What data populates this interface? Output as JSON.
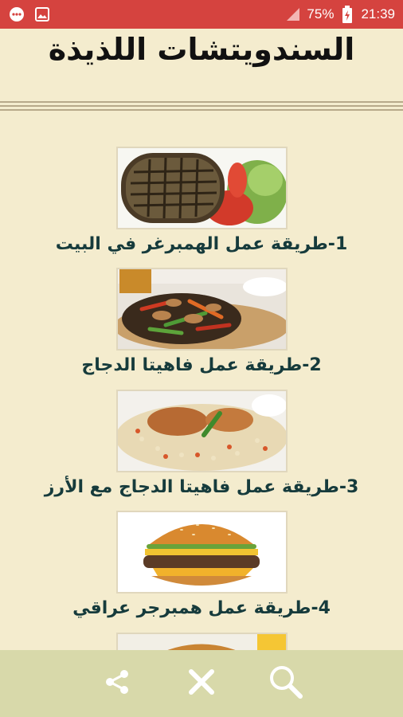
{
  "status_bar": {
    "battery": "75%",
    "time": "21:39",
    "icons": [
      "chat-bubble-icon",
      "image-icon",
      "signal-icon",
      "battery-charging-icon"
    ]
  },
  "header": {
    "title": "السندويتشات اللذيذة"
  },
  "recipes": [
    {
      "label": "1-طريقة عمل الهمبرغر في البيت",
      "image": "burger-patty-image"
    },
    {
      "label": "2-طريقة عمل فاهيتا الدجاج",
      "image": "chicken-fajita-image"
    },
    {
      "label": "3-طريقة عمل فاهيتا الدجاج مع الأرز",
      "image": "chicken-fajita-rice-image"
    },
    {
      "label": "4-طريقة عمل همبرجر عراقي",
      "image": "cheeseburger-image"
    },
    {
      "label": "",
      "image": "sandwich-image-partial"
    }
  ],
  "toolbar": {
    "share": "share-icon",
    "close": "close-icon",
    "search": "search-icon"
  },
  "colors": {
    "status_bar": "#d5433f",
    "background": "#f4ecce",
    "bottom_bar": "#d8d9aa",
    "caption": "#163b3c"
  }
}
